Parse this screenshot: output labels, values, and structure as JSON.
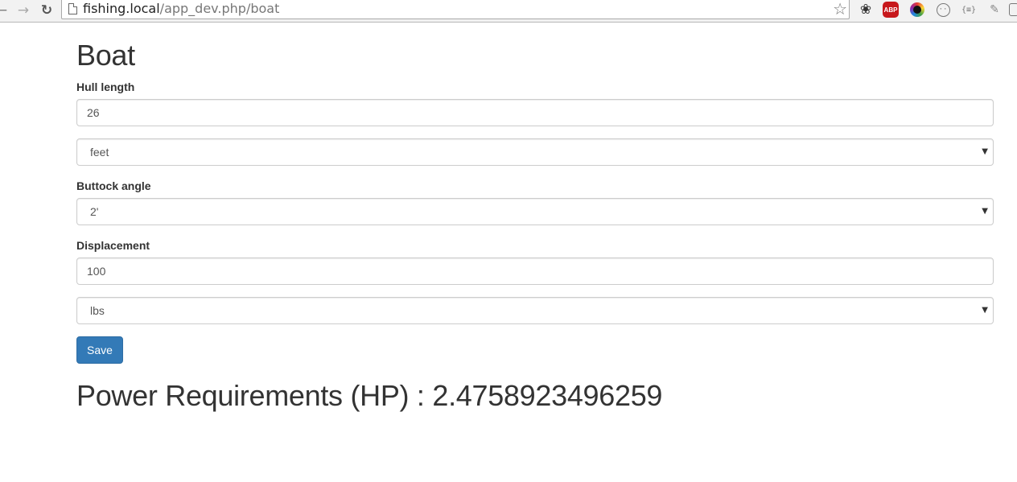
{
  "browser": {
    "url_host": "fishing.local",
    "url_path": "/app_dev.php/boat"
  },
  "icons": {
    "back": "back-arrow-icon",
    "forward": "forward-arrow-icon",
    "reload": "reload-icon",
    "bookmark": "star-icon",
    "extensions": [
      "bug-icon",
      "adblock-icon",
      "color-picker-icon",
      "circle-icon",
      "json-icon",
      "pencil-icon",
      "extension-icon"
    ]
  },
  "extensions": {
    "abp_label": "ABP",
    "json_label": "{≡}"
  },
  "colors": {
    "primary_button": "#337ab7",
    "abp_red": "#c7181c"
  },
  "page": {
    "title": "Boat",
    "hull_length": {
      "label": "Hull length",
      "value": "26",
      "unit": "feet"
    },
    "buttock_angle": {
      "label": "Buttock angle",
      "value": "2'"
    },
    "displacement": {
      "label": "Displacement",
      "value": "100",
      "unit": "lbs"
    },
    "save_label": "Save",
    "result": {
      "label": "Power Requirements (HP) :",
      "value": "2.4758923496259"
    }
  }
}
